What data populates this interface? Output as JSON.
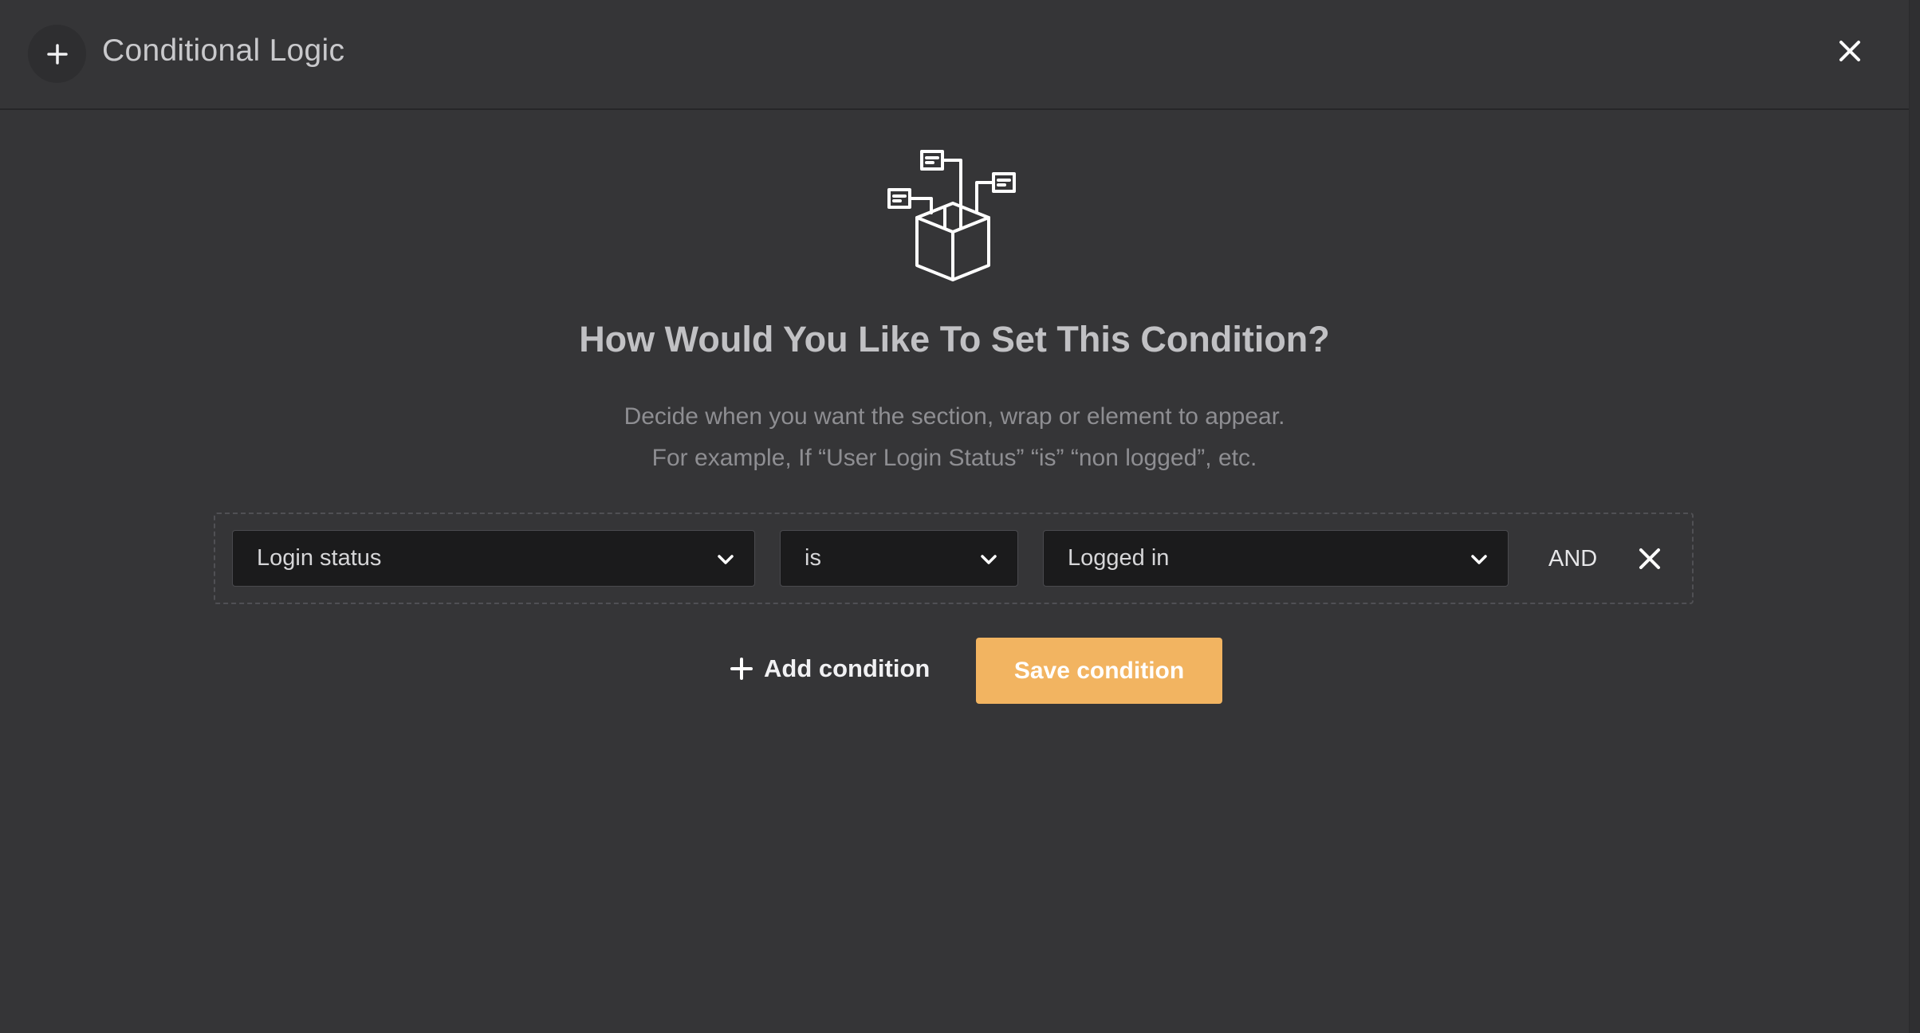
{
  "header": {
    "title": "Conditional Logic",
    "add_icon": "plus-icon",
    "close_icon": "close-icon"
  },
  "illustration": {
    "icon": "logic-box-network-icon"
  },
  "heading": "How Would You Like To Set This Condition?",
  "description": {
    "line1": "Decide when you want the section, wrap or element to appear.",
    "line2": "For example, If “User Login Status” “is” “non logged”, etc."
  },
  "condition": {
    "field": "Login status",
    "operator": "is",
    "value": "Logged in",
    "connector": "AND",
    "remove_icon": "close-icon"
  },
  "actions": {
    "add_label": "Add condition",
    "save_label": "Save condition"
  },
  "colors": {
    "background": "#353537",
    "accent": "#f2b461",
    "select_bg": "#1b1b1c"
  }
}
